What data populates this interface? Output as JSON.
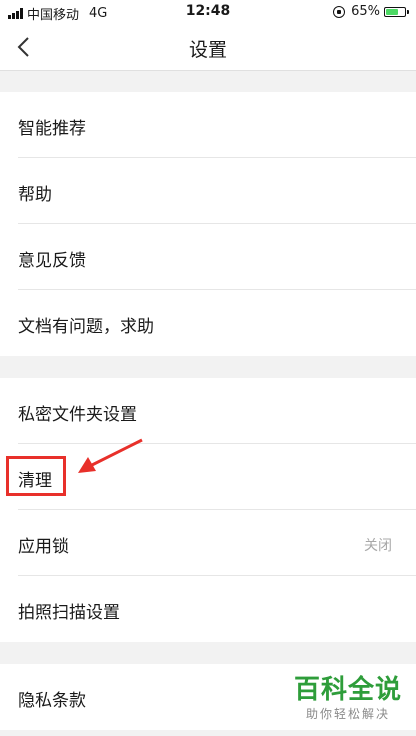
{
  "status_bar": {
    "carrier": "中国移动",
    "network": "4G",
    "time": "12:48",
    "battery": "65%",
    "battery_level": 0.65
  },
  "nav": {
    "title": "设置",
    "back_icon": "chevron-left-icon"
  },
  "groups": [
    {
      "items": [
        {
          "label": "智能推荐"
        },
        {
          "label": "帮助"
        },
        {
          "label": "意见反馈"
        },
        {
          "label": "文档有问题，求助"
        }
      ]
    },
    {
      "items": [
        {
          "label": "私密文件夹设置"
        },
        {
          "label": "清理"
        },
        {
          "label": "应用锁",
          "value": "关闭"
        },
        {
          "label": "拍照扫描设置"
        }
      ]
    },
    {
      "items": [
        {
          "label": "隐私条款"
        }
      ]
    }
  ],
  "annotation": {
    "color": "#e8302a"
  },
  "watermark": {
    "main": "百科全说",
    "sub": "助你轻松解决"
  },
  "colors": {
    "battery": "#4cd964",
    "watermark": "#2e9d3a"
  }
}
